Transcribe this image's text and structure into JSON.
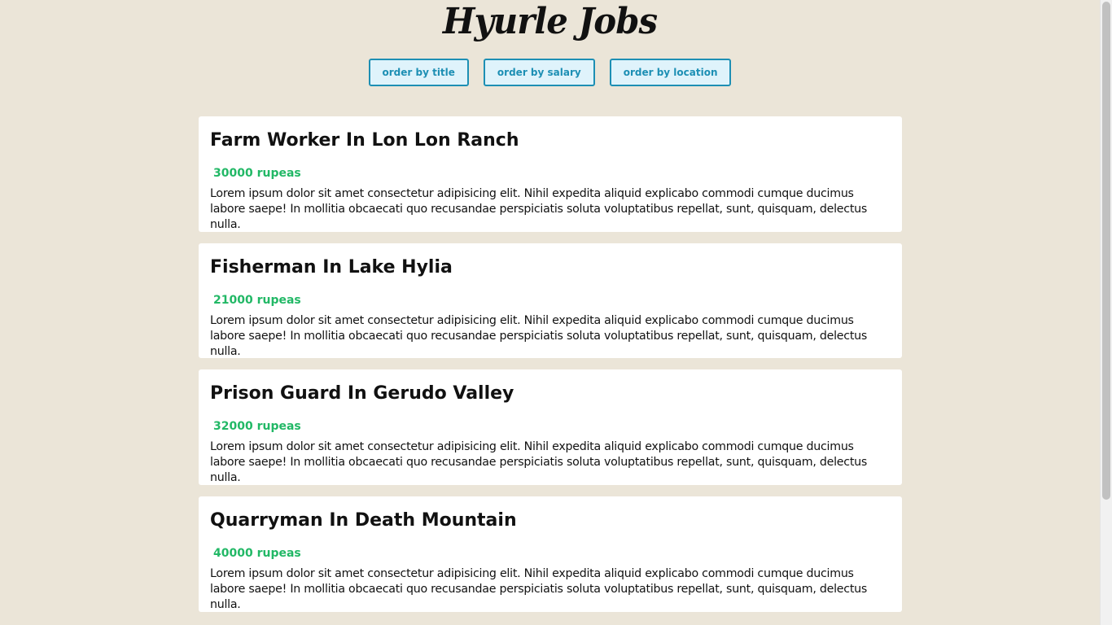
{
  "header": {
    "title": "Hyurle Jobs"
  },
  "sort": {
    "by_title": "order by title",
    "by_salary": "order by salary",
    "by_location": "order by location"
  },
  "jobs": [
    {
      "title": "Farm Worker In Lon Lon Ranch",
      "salary": "30000 rupeas",
      "description": "Lorem ipsum dolor sit amet consectetur adipisicing elit. Nihil expedita aliquid explicabo commodi cumque ducimus labore saepe! In mollitia obcaecati quo recusandae perspiciatis soluta voluptatibus repellat, sunt, quisquam, delectus nulla."
    },
    {
      "title": "Fisherman In Lake Hylia",
      "salary": "21000 rupeas",
      "description": "Lorem ipsum dolor sit amet consectetur adipisicing elit. Nihil expedita aliquid explicabo commodi cumque ducimus labore saepe! In mollitia obcaecati quo recusandae perspiciatis soluta voluptatibus repellat, sunt, quisquam, delectus nulla."
    },
    {
      "title": "Prison Guard In Gerudo Valley",
      "salary": "32000 rupeas",
      "description": "Lorem ipsum dolor sit amet consectetur adipisicing elit. Nihil expedita aliquid explicabo commodi cumque ducimus labore saepe! In mollitia obcaecati quo recusandae perspiciatis soluta voluptatibus repellat, sunt, quisquam, delectus nulla."
    },
    {
      "title": "Quarryman In Death Mountain",
      "salary": "40000 rupeas",
      "description": "Lorem ipsum dolor sit amet consectetur adipisicing elit. Nihil expedita aliquid explicabo commodi cumque ducimus labore saepe! In mollitia obcaecati quo recusandae perspiciatis soluta voluptatibus repellat, sunt, quisquam, delectus nulla."
    }
  ],
  "colors": {
    "background": "#ebe5d8",
    "button_accent": "#1d8fb4",
    "button_fill": "#dff3fb",
    "salary": "#22b866",
    "card": "#ffffff"
  }
}
